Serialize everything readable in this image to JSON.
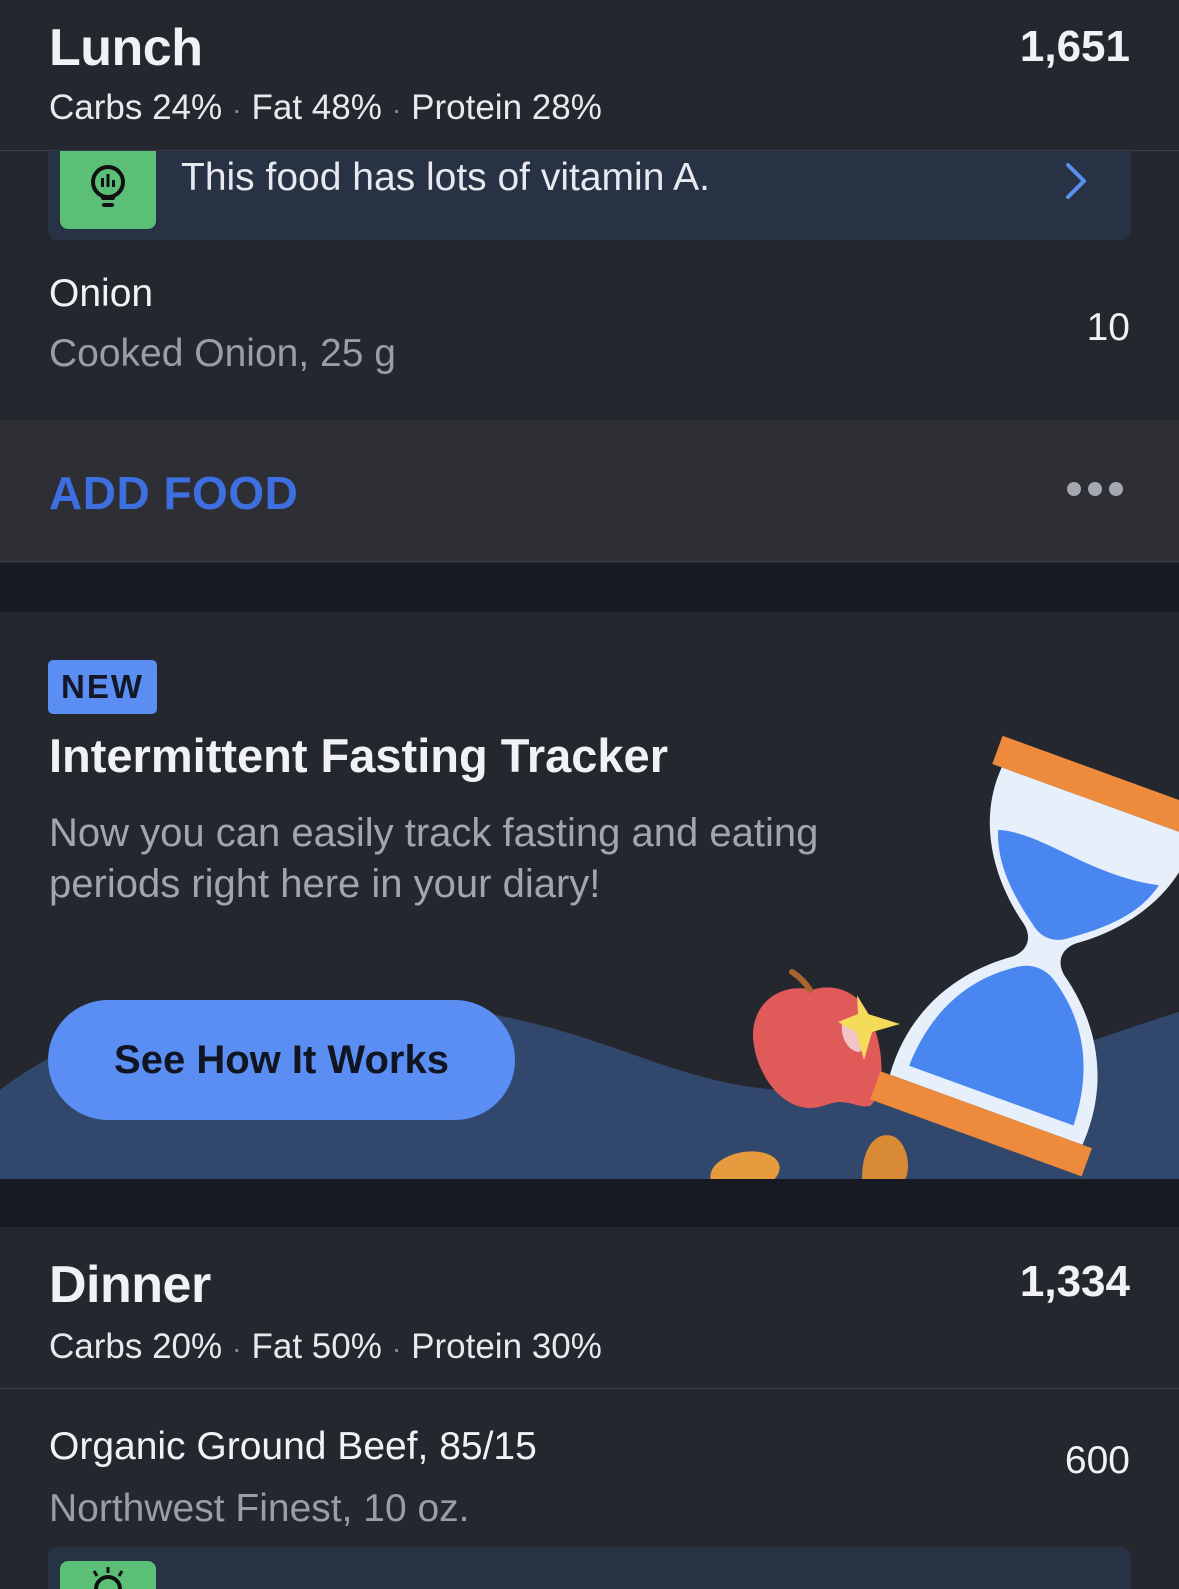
{
  "lunch": {
    "title": "Lunch",
    "calories": "1,651",
    "macros": {
      "carbs": "Carbs 24%",
      "fat": "Fat 48%",
      "protein": "Protein 28%"
    }
  },
  "lunch_tip": {
    "icon": "lightbulb-icon",
    "text": "This food has lots of vitamin A.",
    "chevron": "chevron-right-icon"
  },
  "lunch_items": [
    {
      "name": "Onion",
      "detail": "Cooked Onion, 25 g",
      "calories": "10"
    }
  ],
  "add_food": {
    "label": "ADD FOOD",
    "more_icon": "ellipsis-icon"
  },
  "promo": {
    "badge": "NEW",
    "title": "Intermittent Fasting Tracker",
    "description": "Now you can easily track fasting and eating periods right here in your diary!",
    "button_label": "See How It Works",
    "illustration": "hourglass-apple-illustration"
  },
  "dinner": {
    "title": "Dinner",
    "calories": "1,334",
    "macros": {
      "carbs": "Carbs 20%",
      "fat": "Fat 50%",
      "protein": "Protein 30%"
    }
  },
  "dinner_items": [
    {
      "name": "Organic Ground Beef, 85/15",
      "detail": "Northwest Finest, 10 oz.",
      "calories": "600"
    }
  ],
  "colors": {
    "background": "#25272f",
    "accent_blue": "#5a8ef3",
    "add_food_blue": "#3d6fe0",
    "tip_green": "#5bbf77",
    "separator": "#171923"
  }
}
